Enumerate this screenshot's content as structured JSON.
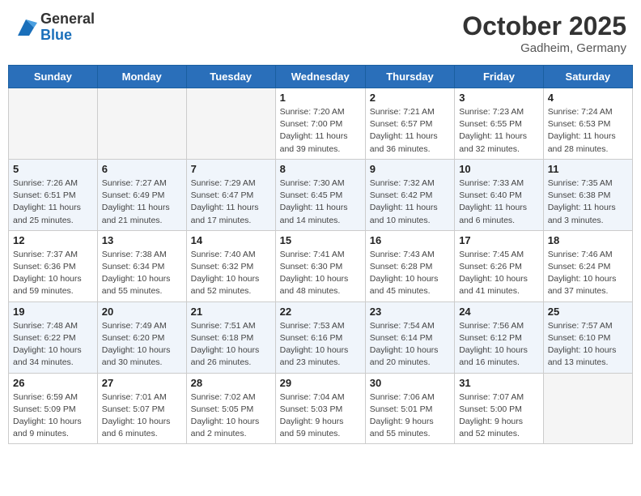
{
  "header": {
    "logo_general": "General",
    "logo_blue": "Blue",
    "month_title": "October 2025",
    "location": "Gadheim, Germany"
  },
  "days_of_week": [
    "Sunday",
    "Monday",
    "Tuesday",
    "Wednesday",
    "Thursday",
    "Friday",
    "Saturday"
  ],
  "weeks": [
    [
      {
        "day": "",
        "info": ""
      },
      {
        "day": "",
        "info": ""
      },
      {
        "day": "",
        "info": ""
      },
      {
        "day": "1",
        "info": "Sunrise: 7:20 AM\nSunset: 7:00 PM\nDaylight: 11 hours\nand 39 minutes."
      },
      {
        "day": "2",
        "info": "Sunrise: 7:21 AM\nSunset: 6:57 PM\nDaylight: 11 hours\nand 36 minutes."
      },
      {
        "day": "3",
        "info": "Sunrise: 7:23 AM\nSunset: 6:55 PM\nDaylight: 11 hours\nand 32 minutes."
      },
      {
        "day": "4",
        "info": "Sunrise: 7:24 AM\nSunset: 6:53 PM\nDaylight: 11 hours\nand 28 minutes."
      }
    ],
    [
      {
        "day": "5",
        "info": "Sunrise: 7:26 AM\nSunset: 6:51 PM\nDaylight: 11 hours\nand 25 minutes."
      },
      {
        "day": "6",
        "info": "Sunrise: 7:27 AM\nSunset: 6:49 PM\nDaylight: 11 hours\nand 21 minutes."
      },
      {
        "day": "7",
        "info": "Sunrise: 7:29 AM\nSunset: 6:47 PM\nDaylight: 11 hours\nand 17 minutes."
      },
      {
        "day": "8",
        "info": "Sunrise: 7:30 AM\nSunset: 6:45 PM\nDaylight: 11 hours\nand 14 minutes."
      },
      {
        "day": "9",
        "info": "Sunrise: 7:32 AM\nSunset: 6:42 PM\nDaylight: 11 hours\nand 10 minutes."
      },
      {
        "day": "10",
        "info": "Sunrise: 7:33 AM\nSunset: 6:40 PM\nDaylight: 11 hours\nand 6 minutes."
      },
      {
        "day": "11",
        "info": "Sunrise: 7:35 AM\nSunset: 6:38 PM\nDaylight: 11 hours\nand 3 minutes."
      }
    ],
    [
      {
        "day": "12",
        "info": "Sunrise: 7:37 AM\nSunset: 6:36 PM\nDaylight: 10 hours\nand 59 minutes."
      },
      {
        "day": "13",
        "info": "Sunrise: 7:38 AM\nSunset: 6:34 PM\nDaylight: 10 hours\nand 55 minutes."
      },
      {
        "day": "14",
        "info": "Sunrise: 7:40 AM\nSunset: 6:32 PM\nDaylight: 10 hours\nand 52 minutes."
      },
      {
        "day": "15",
        "info": "Sunrise: 7:41 AM\nSunset: 6:30 PM\nDaylight: 10 hours\nand 48 minutes."
      },
      {
        "day": "16",
        "info": "Sunrise: 7:43 AM\nSunset: 6:28 PM\nDaylight: 10 hours\nand 45 minutes."
      },
      {
        "day": "17",
        "info": "Sunrise: 7:45 AM\nSunset: 6:26 PM\nDaylight: 10 hours\nand 41 minutes."
      },
      {
        "day": "18",
        "info": "Sunrise: 7:46 AM\nSunset: 6:24 PM\nDaylight: 10 hours\nand 37 minutes."
      }
    ],
    [
      {
        "day": "19",
        "info": "Sunrise: 7:48 AM\nSunset: 6:22 PM\nDaylight: 10 hours\nand 34 minutes."
      },
      {
        "day": "20",
        "info": "Sunrise: 7:49 AM\nSunset: 6:20 PM\nDaylight: 10 hours\nand 30 minutes."
      },
      {
        "day": "21",
        "info": "Sunrise: 7:51 AM\nSunset: 6:18 PM\nDaylight: 10 hours\nand 26 minutes."
      },
      {
        "day": "22",
        "info": "Sunrise: 7:53 AM\nSunset: 6:16 PM\nDaylight: 10 hours\nand 23 minutes."
      },
      {
        "day": "23",
        "info": "Sunrise: 7:54 AM\nSunset: 6:14 PM\nDaylight: 10 hours\nand 20 minutes."
      },
      {
        "day": "24",
        "info": "Sunrise: 7:56 AM\nSunset: 6:12 PM\nDaylight: 10 hours\nand 16 minutes."
      },
      {
        "day": "25",
        "info": "Sunrise: 7:57 AM\nSunset: 6:10 PM\nDaylight: 10 hours\nand 13 minutes."
      }
    ],
    [
      {
        "day": "26",
        "info": "Sunrise: 6:59 AM\nSunset: 5:09 PM\nDaylight: 10 hours\nand 9 minutes."
      },
      {
        "day": "27",
        "info": "Sunrise: 7:01 AM\nSunset: 5:07 PM\nDaylight: 10 hours\nand 6 minutes."
      },
      {
        "day": "28",
        "info": "Sunrise: 7:02 AM\nSunset: 5:05 PM\nDaylight: 10 hours\nand 2 minutes."
      },
      {
        "day": "29",
        "info": "Sunrise: 7:04 AM\nSunset: 5:03 PM\nDaylight: 9 hours\nand 59 minutes."
      },
      {
        "day": "30",
        "info": "Sunrise: 7:06 AM\nSunset: 5:01 PM\nDaylight: 9 hours\nand 55 minutes."
      },
      {
        "day": "31",
        "info": "Sunrise: 7:07 AM\nSunset: 5:00 PM\nDaylight: 9 hours\nand 52 minutes."
      },
      {
        "day": "",
        "info": ""
      }
    ]
  ]
}
